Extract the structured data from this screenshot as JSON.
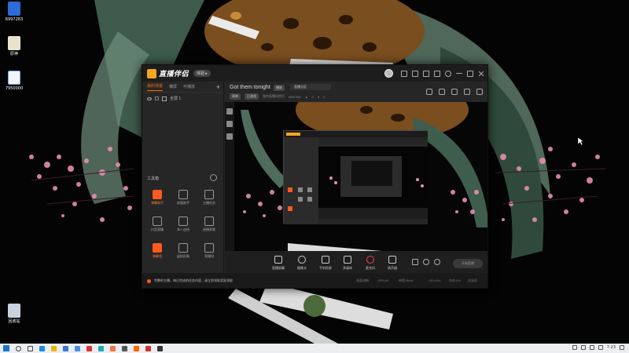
{
  "desktop": {
    "icons": [
      {
        "name": "6997283",
        "icon": "app-icon"
      },
      {
        "name": "原神",
        "icon": "game-icon"
      },
      {
        "name": "7950000",
        "icon": "document-icon"
      },
      {
        "name": "回收站",
        "icon": "recycle-bin-icon"
      }
    ]
  },
  "app": {
    "logo_text": "直播伴侣",
    "version_badge": "体验 ▸",
    "scene_tabs": [
      "我的场景",
      "横屏",
      "可播放"
    ],
    "scene_item": "全屏 1",
    "toolbox_title": "工具箱",
    "tools": [
      {
        "label": "弹幕助手",
        "icon": "danmaku-icon",
        "hot": true
      },
      {
        "label": "房管助手",
        "icon": "admin-icon",
        "hot": false
      },
      {
        "label": "主播任务",
        "icon": "task-icon",
        "hot": false
      },
      {
        "label": "抖音直播",
        "icon": "douyin-icon",
        "hot": false
      },
      {
        "label": "多人连线",
        "icon": "download-icon",
        "hot": false
      },
      {
        "label": "直播背景",
        "icon": "background-icon",
        "hot": false
      },
      {
        "label": "弹幕墙",
        "icon": "wall-icon",
        "hot": true
      },
      {
        "label": "虚拟形象",
        "icon": "download-icon",
        "hot": false
      },
      {
        "label": "直播间",
        "icon": "room-icon",
        "hot": false
      }
    ],
    "stream_title": "Got them tonight",
    "edit_tag": "播放",
    "category_tag": "直播分区",
    "meta": [
      "原神",
      "已游戏",
      "我的直播间首页",
      "6997283"
    ],
    "meta_counts": [
      "0",
      "0"
    ],
    "bottom_tools": [
      {
        "label": "直播屏幕",
        "icon": "screen-share-icon"
      },
      {
        "label": "摄像头",
        "icon": "camera-icon"
      },
      {
        "label": "手机投屏",
        "icon": "phone-cast-icon"
      },
      {
        "label": "多媒体",
        "icon": "media-icon"
      },
      {
        "label": "麦克风",
        "icon": "microphone-icon"
      },
      {
        "label": "扬声器",
        "icon": "speaker-icon"
      }
    ],
    "start_button": "开始直播",
    "notice": "完整的主播，每日完成的任务内容，请立即领取奖励领取",
    "status_stats": [
      "画面流畅",
      "FPS:60",
      "带宽:0kb/s",
      "CPU:6%",
      "内存:5%",
      "本场次"
    ]
  },
  "taskbar": {
    "time": "7:23",
    "apps": [
      "search",
      "taskview",
      "browser",
      "files",
      "mail",
      "store",
      "app1",
      "app2",
      "app3",
      "app4",
      "app5",
      "app6",
      "app7"
    ]
  },
  "colors": {
    "accent": "#ff5a1f",
    "window_bg": "#232323",
    "taskbar_bg": "#eceef2"
  }
}
